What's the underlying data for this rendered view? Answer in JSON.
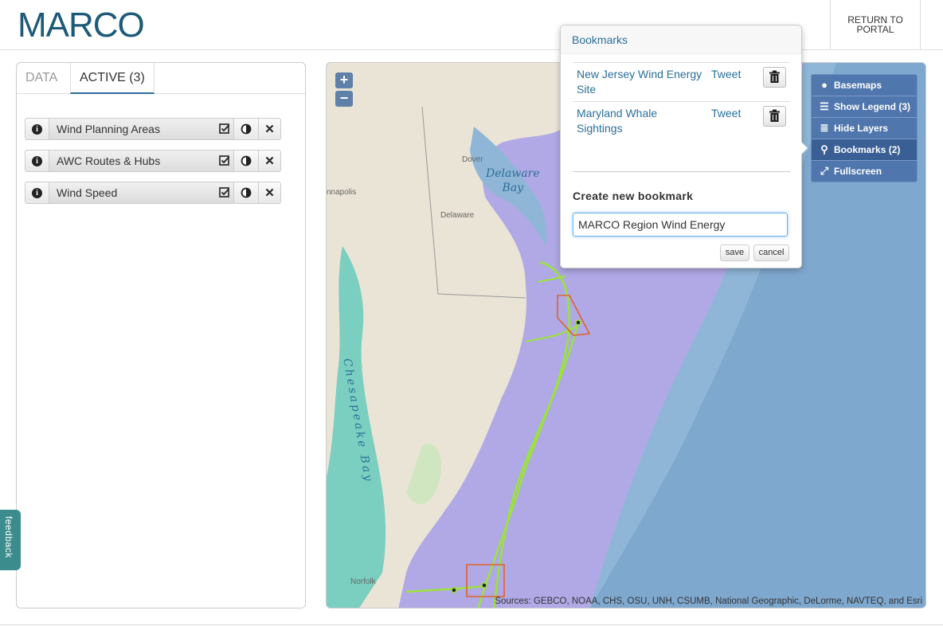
{
  "header": {
    "logo_text": "MARCO",
    "return_label": "RETURN TO\nPORTAL"
  },
  "tabs": [
    {
      "label": "DATA",
      "active": false
    },
    {
      "label": "ACTIVE (3)",
      "active": true
    }
  ],
  "active_layers": [
    {
      "name": "Wind Planning Areas"
    },
    {
      "name": "AWC Routes & Hubs"
    },
    {
      "name": "Wind Speed"
    }
  ],
  "feedback_label": "feedback",
  "map": {
    "zoom_in": "+",
    "zoom_out": "−",
    "attribution": "Sources: GEBCO, NOAA, CHS, OSU, UNH, CSUMB, National Geographic, DeLorme, NAVTEQ, and Esri",
    "places": {
      "dover": "Dover",
      "delaware": "Delaware",
      "annapolis": "nnapolis",
      "norfolk": "Norfolk"
    },
    "water": {
      "delaware_bay_1": "Delaware",
      "delaware_bay_2": "Bay",
      "chesapeake": "Chesapeake Bay"
    }
  },
  "map_controls": [
    {
      "label": "Basemaps",
      "icon": "globe-icon",
      "selected": false
    },
    {
      "label": "Show Legend (3)",
      "icon": "list-icon",
      "selected": false
    },
    {
      "label": "Hide Layers",
      "icon": "layers-icon",
      "selected": false
    },
    {
      "label": "Bookmarks (2)",
      "icon": "map-marker-icon",
      "selected": true
    },
    {
      "label": "Fullscreen",
      "icon": "fullscreen-icon",
      "selected": false
    }
  ],
  "bookmarks_popup": {
    "title": "Bookmarks",
    "items": [
      {
        "name": "New Jersey Wind Energy Site",
        "tweet": "Tweet"
      },
      {
        "name": "Maryland Whale Sightings",
        "tweet": "Tweet"
      }
    ],
    "create_label": "Create new bookmark",
    "input_value": "MARCO Region Wind Energy",
    "save_label": "save",
    "cancel_label": "cancel"
  }
}
